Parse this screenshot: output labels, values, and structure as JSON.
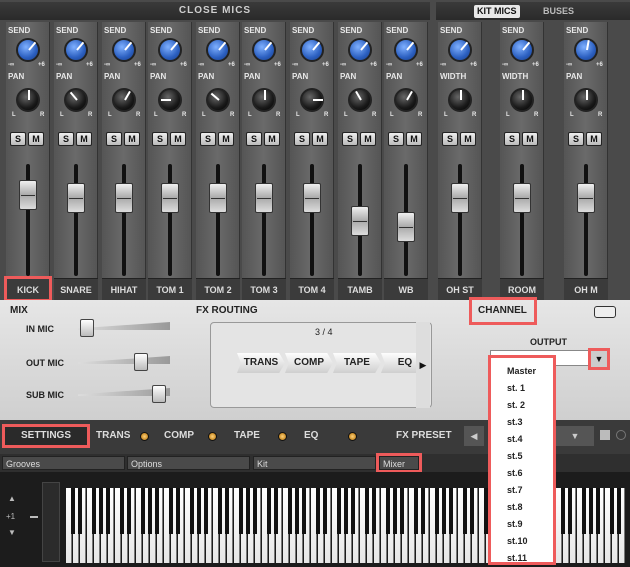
{
  "mixer": {
    "close_mics_title": "CLOSE MICS",
    "kit_mics_tab": "KIT MICS",
    "buses_tab": "BUSES",
    "send_label": "SEND",
    "pan_label": "PAN",
    "width_label": "WIDTH",
    "minus_inf": "-∞",
    "plus_six": "+6",
    "left_mark": "L",
    "right_mark": "R",
    "solo_label": "S",
    "mute_label": "M",
    "channels": [
      {
        "name": "KICK"
      },
      {
        "name": "SNARE"
      },
      {
        "name": "HIHAT"
      },
      {
        "name": "TOM 1"
      },
      {
        "name": "TOM 2"
      },
      {
        "name": "TOM 3"
      },
      {
        "name": "TOM 4"
      },
      {
        "name": "TAMB"
      },
      {
        "name": "WB"
      },
      {
        "name": "OH ST"
      },
      {
        "name": "ROOM"
      },
      {
        "name": "OH M"
      }
    ]
  },
  "panel": {
    "mix_title": "MIX",
    "in_mic": "IN MIC",
    "out_mic": "OUT MIC",
    "sub_mic": "SUB MIC",
    "fx_routing_title": "FX ROUTING",
    "fx_page": "3 / 4",
    "fx_chain": [
      "TRANS",
      "COMP",
      "TAPE",
      "EQ"
    ],
    "channel_title": "CHANNEL",
    "output_label": "OUTPUT"
  },
  "bar": {
    "settings": "SETTINGS",
    "modules": [
      "TRANS",
      "COMP",
      "TAPE",
      "EQ"
    ],
    "fx_preset": "FX PRESET"
  },
  "tabs": {
    "items": [
      "Grooves",
      "Options",
      "Kit",
      "Mixer"
    ]
  },
  "keyboard": {
    "octave_shift": "+1"
  },
  "output_dropdown": {
    "options": [
      "Master",
      "st. 1",
      "st. 2",
      "st.3",
      "st.4",
      "st.5",
      "st.6",
      "st.7",
      "st.8",
      "st.9",
      "st.10",
      "st.11"
    ]
  },
  "colors": {
    "highlight": "#ee5b5b",
    "knob_blue": "#2b5fc0"
  }
}
